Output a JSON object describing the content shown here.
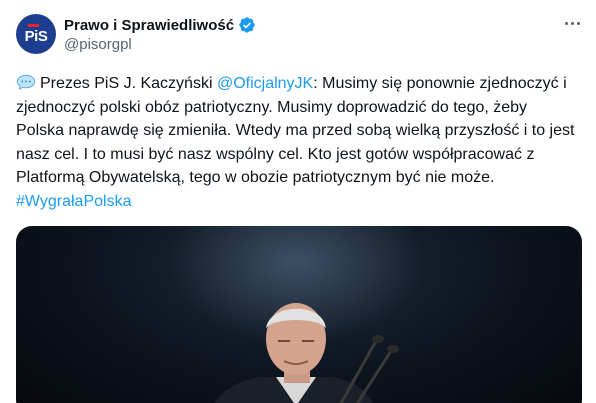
{
  "author": {
    "display_name": "Prawo i Sprawiedliwość",
    "handle": "@pisorgpl",
    "avatar_logo": "PiS",
    "verified_color": "#1d9bf0"
  },
  "tweet": {
    "lead_icon": "speech-bubble-icon",
    "text_before": "Prezes PiS J. Kaczyński ",
    "mention": "@OficjalnyJK",
    "text_after": ": Musimy się ponownie zjednoczyć i zjednoczyć polski obóz patriotyczny. Musimy doprowadzić do tego, żeby Polska naprawdę się zmieniła. Wtedy ma przed sobą wielką przyszłość i to jest nasz cel. I to musi być nasz wspólny cel. Kto jest gotów współpracować z Platformą Obywatelską, tego w obozie patriotycznym być nie może. ",
    "hashtag": "#WygrałaPolska",
    "link_color": "#1d9bf0"
  },
  "media": {
    "icon": "photo-speaker-at-microphones"
  }
}
